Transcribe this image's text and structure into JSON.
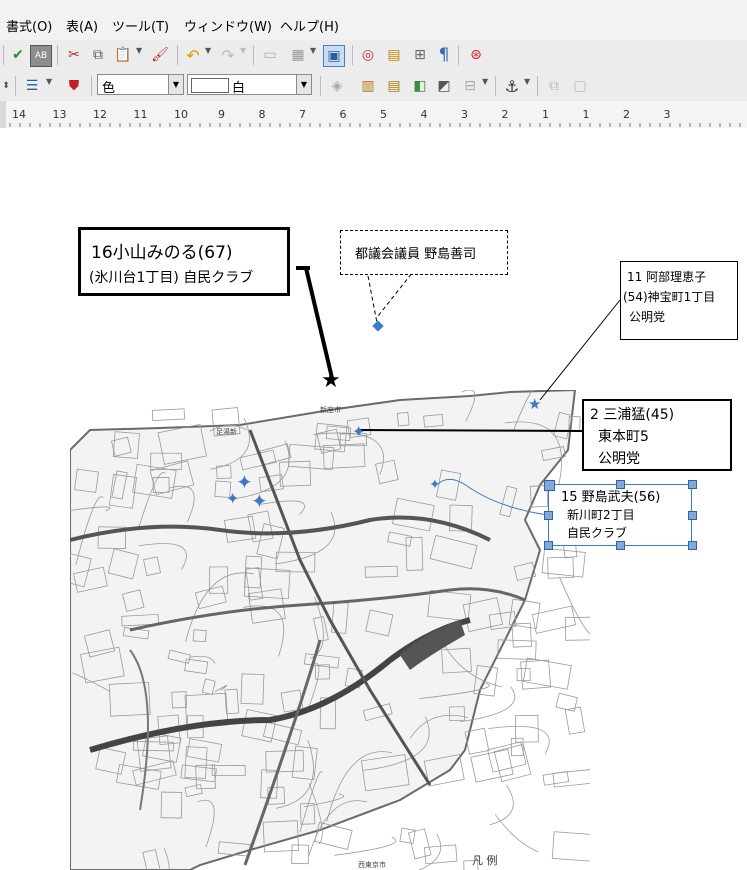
{
  "menu": {
    "items": [
      {
        "label": "書式(O)"
      },
      {
        "label": "表(A)"
      },
      {
        "label": "ツール(T)"
      },
      {
        "label": "ウィンドウ(W)"
      },
      {
        "label": "ヘルプ(H)"
      }
    ]
  },
  "toolbar2": {
    "color_label": "色",
    "fill_value": "白"
  },
  "ruler": {
    "numbers": [
      "14",
      "13",
      "12",
      "11",
      "10",
      "9",
      "8",
      "7",
      "6",
      "5",
      "4",
      "3",
      "2",
      "1",
      "1",
      "2",
      "3"
    ]
  },
  "colors": {
    "selection": "#3c78c8",
    "star_blue": "#3f79c6",
    "map_line": "#555555"
  },
  "labels": {
    "koyama": {
      "line1": "16小山みのる(67)",
      "line2": "(氷川台1丁目) 自民クラブ"
    },
    "tomin": {
      "line1": "都議会議員 野島善司"
    },
    "abe": {
      "line1": "11 阿部理恵子",
      "line2": "(54)神宝町1丁目",
      "line3": "公明党"
    },
    "miura": {
      "line1": "2 三浦猛(45)",
      "line2": "東本町5",
      "line3": "公明党"
    },
    "nojima": {
      "line1": "15 野島武夫(56)",
      "line2": "新川町2丁目",
      "line3": "自民クラブ"
    }
  },
  "map_text": {
    "legend": "凡 例",
    "bottom": "西東京市",
    "north": "新座市",
    "left_top": "足湯新"
  }
}
